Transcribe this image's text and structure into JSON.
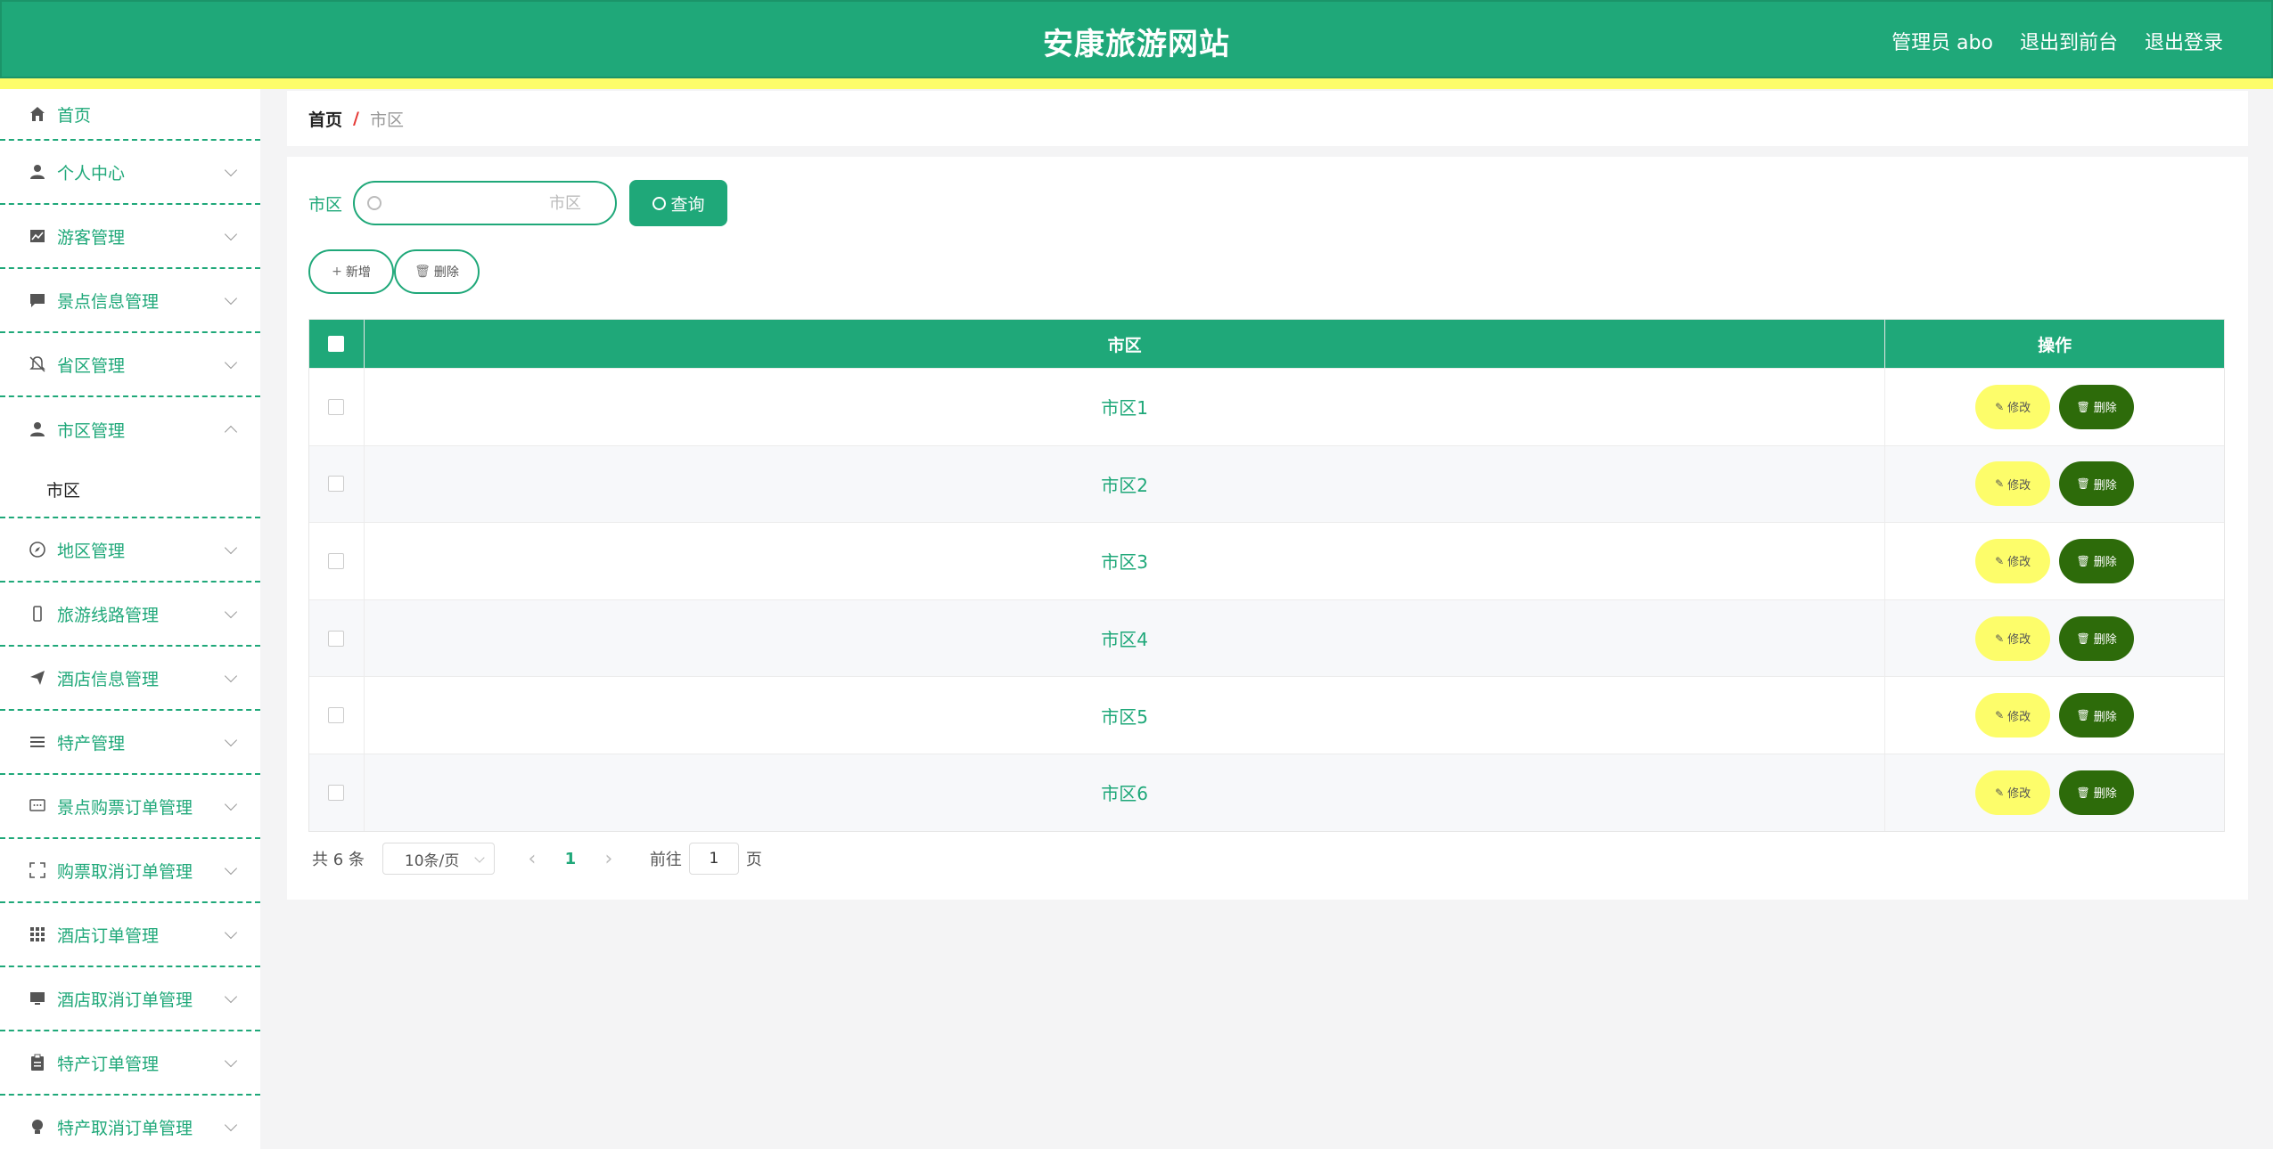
{
  "header": {
    "title": "安康旅游网站",
    "links": [
      "管理员 abo",
      "退出到前台",
      "退出登录"
    ]
  },
  "sidebar": {
    "home": "首页",
    "items": [
      {
        "label": "个人中心",
        "icon": "user-icon"
      },
      {
        "label": "游客管理",
        "icon": "chart-icon"
      },
      {
        "label": "景点信息管理",
        "icon": "chat-icon"
      },
      {
        "label": "省区管理",
        "icon": "bell-off-icon"
      },
      {
        "label": "市区管理",
        "icon": "user-icon",
        "open": true,
        "sub": "市区"
      },
      {
        "label": "地区管理",
        "icon": "compass-icon"
      },
      {
        "label": "旅游线路管理",
        "icon": "phone-icon"
      },
      {
        "label": "酒店信息管理",
        "icon": "send-icon"
      },
      {
        "label": "特产管理",
        "icon": "list-icon"
      },
      {
        "label": "景点购票订单管理",
        "icon": "message-icon"
      },
      {
        "label": "购票取消订单管理",
        "icon": "fullscreen-icon"
      },
      {
        "label": "酒店订单管理",
        "icon": "grid-icon"
      },
      {
        "label": "酒店取消订单管理",
        "icon": "monitor-icon"
      },
      {
        "label": "特产订单管理",
        "icon": "clipboard-icon"
      },
      {
        "label": "特产取消订单管理",
        "icon": "bulb-icon"
      }
    ]
  },
  "breadcrumb": {
    "home": "首页",
    "separator": "/",
    "current": "市区"
  },
  "search": {
    "label": "市区",
    "placeholder": "市区",
    "value": "",
    "button": "查询"
  },
  "actions": {
    "add": "新增",
    "delete": "删除"
  },
  "table": {
    "headers": {
      "name": "市区",
      "ops": "操作"
    },
    "rows": [
      "市区1",
      "市区2",
      "市区3",
      "市区4",
      "市区5",
      "市区6"
    ],
    "edit_label": "修改",
    "delete_label": "删除"
  },
  "pagination": {
    "total": "共 6 条",
    "page_size": "10条/页",
    "current_page": "1",
    "goto_prefix": "前往",
    "goto_value": "1",
    "goto_suffix": "页"
  },
  "colors": {
    "primary": "#1fa879",
    "accent_yellow": "#fdfd6a",
    "delete_green": "#2d6b0a"
  }
}
